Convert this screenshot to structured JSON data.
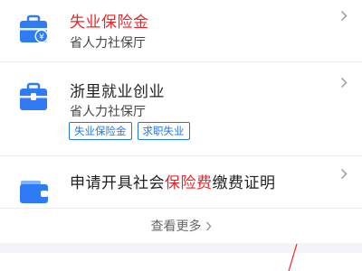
{
  "items": [
    {
      "title": "失业保险金",
      "subtitle": "省人力社保厅",
      "icon": "briefcase-yuan-icon"
    },
    {
      "title": "浙里就业创业",
      "subtitle": "省人力社保厅",
      "icon": "briefcase-icon",
      "tags": [
        "失业保险金",
        "求职失业"
      ]
    },
    {
      "title_before": "申请开具社会",
      "title_highlight": "保险费",
      "title_after": "缴费证明",
      "icon": "wallet-icon"
    }
  ],
  "more": {
    "label": "查看更多"
  },
  "colors": {
    "accent_blue": "#1e77e6",
    "highlight_red": "#e8262a",
    "icon_blue": "#2f7bf5"
  }
}
